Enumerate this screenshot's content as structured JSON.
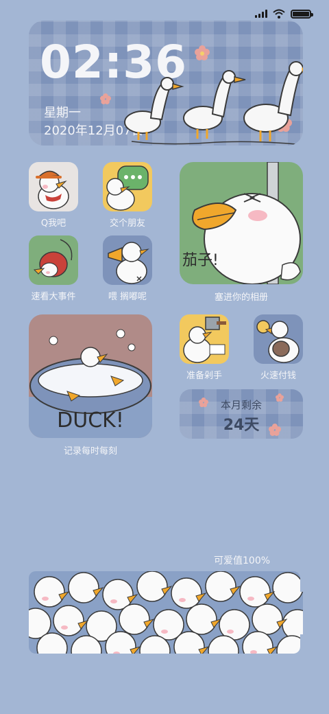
{
  "status_bar": {
    "signal": "signal-icon",
    "wifi": "wifi-icon",
    "battery": "battery-icon",
    "battery_level": 1.0
  },
  "clock_widget": {
    "time": "02:36",
    "weekday": "星期一",
    "date": "2020年12月07日"
  },
  "apps": [
    {
      "label": "Q我吧",
      "icon": "duck-hat-icon"
    },
    {
      "label": "交个朋友",
      "icon": "duck-phone-icon"
    },
    {
      "label": "速看大事件",
      "icon": "duck-bird-icon"
    },
    {
      "label": "喂 搁嘟呢",
      "icon": "duck-megaphone-icon"
    },
    {
      "label": "准备剁手",
      "icon": "duck-cleaver-icon"
    },
    {
      "label": "火速付钱",
      "icon": "duck-money-icon"
    }
  ],
  "photo_widget": {
    "label": "塞进你的相册",
    "caption": "茄子!"
  },
  "moment_widget": {
    "label": "记录每时每刻",
    "caption": "DUCK!"
  },
  "countdown_widget": {
    "title": "本月剩余",
    "value": "24天"
  },
  "cute_battery": {
    "label": "可爱值100%",
    "level": 1.0
  },
  "colors": {
    "background": "#a3b6d4",
    "plaid": "#7e93ba",
    "beak": "#f0a72c"
  }
}
